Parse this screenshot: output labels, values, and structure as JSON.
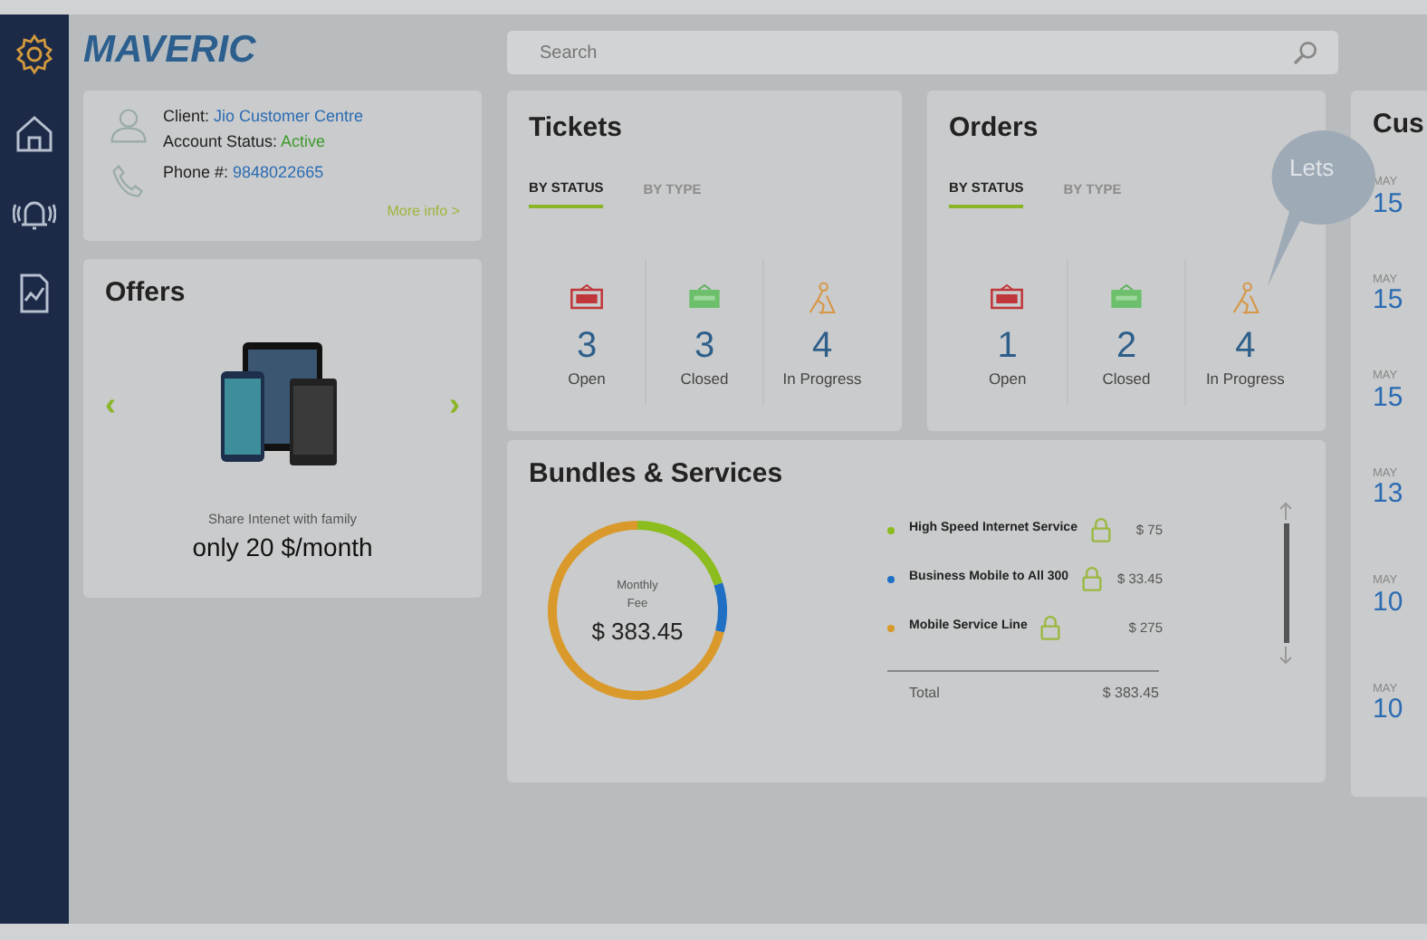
{
  "sidebar": {
    "items": [
      {
        "kind": "settings",
        "selected": true
      },
      {
        "kind": "home",
        "selected": false
      },
      {
        "kind": "alarm",
        "selected": false
      },
      {
        "kind": "report",
        "selected": false
      }
    ]
  },
  "logo": {
    "text": "MAVERIC"
  },
  "search": {
    "placeholder": "Search"
  },
  "client": {
    "client_label": "Client:",
    "client_name": "Jio Customer Centre",
    "status_label": "Account Status:",
    "status": "Active",
    "phone_label": "Phone #:",
    "phone": "9848022665",
    "more_link": "More info >"
  },
  "offers": {
    "title": "Offers",
    "prev": "‹",
    "next": "›",
    "caption": "Share Intenet with family",
    "headline": "only 20 $/month"
  },
  "panels": [
    {
      "title": "Tickets",
      "tabs": [
        {
          "label": "BY STATUS",
          "selected": true
        },
        {
          "label": "BY TYPE",
          "selected": false
        }
      ],
      "stats": [
        {
          "kind": "open",
          "value": "3",
          "label": "Open"
        },
        {
          "kind": "closed",
          "value": "3",
          "label": "Closed"
        },
        {
          "kind": "progress",
          "value": "4",
          "label": "In Progress"
        }
      ]
    },
    {
      "title": "Orders",
      "tabs": [
        {
          "label": "BY STATUS",
          "selected": true
        },
        {
          "label": "BY TYPE",
          "selected": false
        }
      ],
      "stats": [
        {
          "kind": "open",
          "value": "1",
          "label": "Open"
        },
        {
          "kind": "closed",
          "value": "2",
          "label": "Closed"
        },
        {
          "kind": "progress",
          "value": "4",
          "label": "In Progress"
        }
      ]
    }
  ],
  "bundles": {
    "title": "Bundles & Services",
    "fee_label_1": "Monthly",
    "fee_label_2": "Fee",
    "fee": "$ 383.45",
    "services": [
      {
        "name": "High Speed Internet Service",
        "price": "$ 75",
        "color": "#8bbd1e"
      },
      {
        "name": "Business Mobile to All 300",
        "price": "$ 33.45",
        "color": "#1f6fc4"
      },
      {
        "name": "Mobile Service Line",
        "price": "$ 275",
        "color": "#d99a2b"
      }
    ],
    "total_label": "Total",
    "total": "$ 383.45"
  },
  "customer": {
    "title": "Cus",
    "dates": [
      {
        "month": "MAY",
        "day": "15"
      },
      {
        "month": "MAY",
        "day": "15"
      },
      {
        "month": "MAY",
        "day": "15"
      },
      {
        "month": "MAY",
        "day": "13"
      },
      {
        "month": "MAY",
        "day": "10"
      },
      {
        "month": "MAY",
        "day": "10"
      }
    ]
  },
  "tooltip": {
    "text": "Lets"
  }
}
